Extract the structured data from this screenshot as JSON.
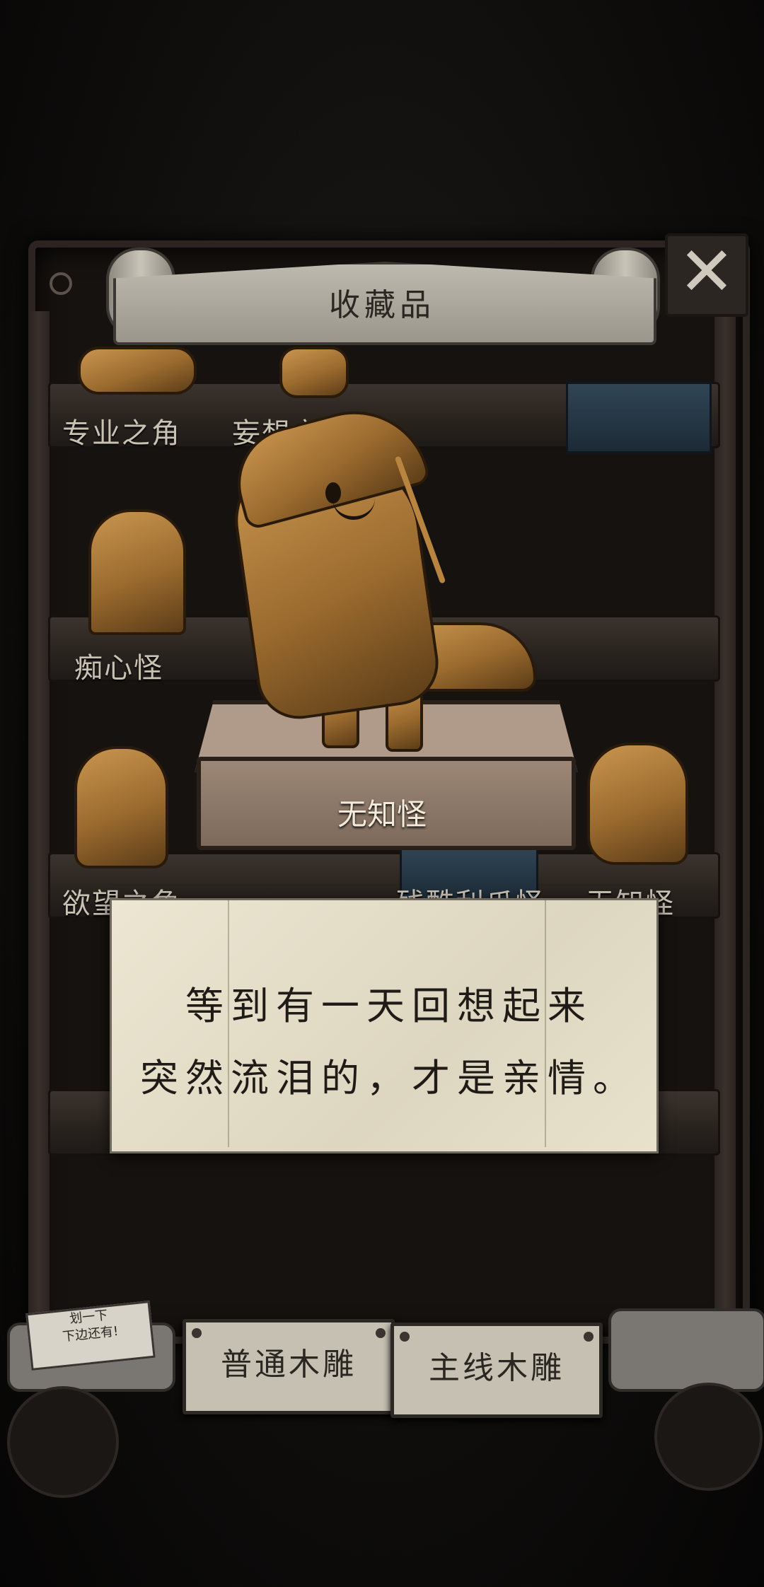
{
  "header": {
    "title": "收藏品",
    "close_icon": "close-icon"
  },
  "shelves": [
    {
      "labels": [
        "专业之角",
        "妄想之角"
      ]
    },
    {
      "labels": [
        "痴心怪"
      ]
    },
    {
      "labels": [
        "欲望之角",
        "残酷利爪怪",
        "无知怪"
      ]
    }
  ],
  "featured": {
    "name": "无知怪"
  },
  "note": {
    "line1": "等到有一天回想起来",
    "line2": "突然流泪的，才是亲情。"
  },
  "hint_sign": {
    "line1": "划一下",
    "line2": "下边还有!"
  },
  "tabs": [
    {
      "label": "普通木雕"
    },
    {
      "label": "主线木雕"
    }
  ]
}
